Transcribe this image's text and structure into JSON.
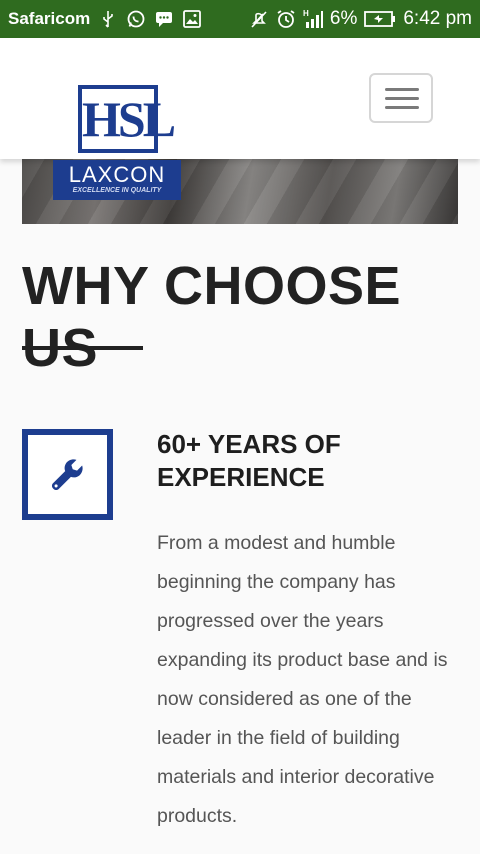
{
  "status_bar": {
    "carrier": "Safaricom",
    "battery": "6%",
    "time": "6:42 pm",
    "icons": [
      "usb-icon",
      "whatsapp-icon",
      "messaging-icon",
      "gallery-icon",
      "mute-icon",
      "alarm-icon",
      "signal-icon",
      "battery-icon"
    ],
    "network": "H"
  },
  "header": {
    "logo_text": "HSL",
    "brand_name": "LAXCON",
    "brand_tagline": "EXCELLENCE IN QUALITY"
  },
  "section": {
    "title": "WHY CHOOSE US"
  },
  "feature": {
    "icon": "wrench-icon",
    "title": "60+ YEARS OF EXPERIENCE",
    "text": "From a modest and humble beginning the company has progressed over the years expanding its product base and is now considered as one of the leader in the field of building materials and interior decorative products."
  },
  "colors": {
    "status_bar": "#2f6b1f",
    "brand_blue": "#1d3d8f",
    "heading": "#222222",
    "body_text": "#555555"
  }
}
